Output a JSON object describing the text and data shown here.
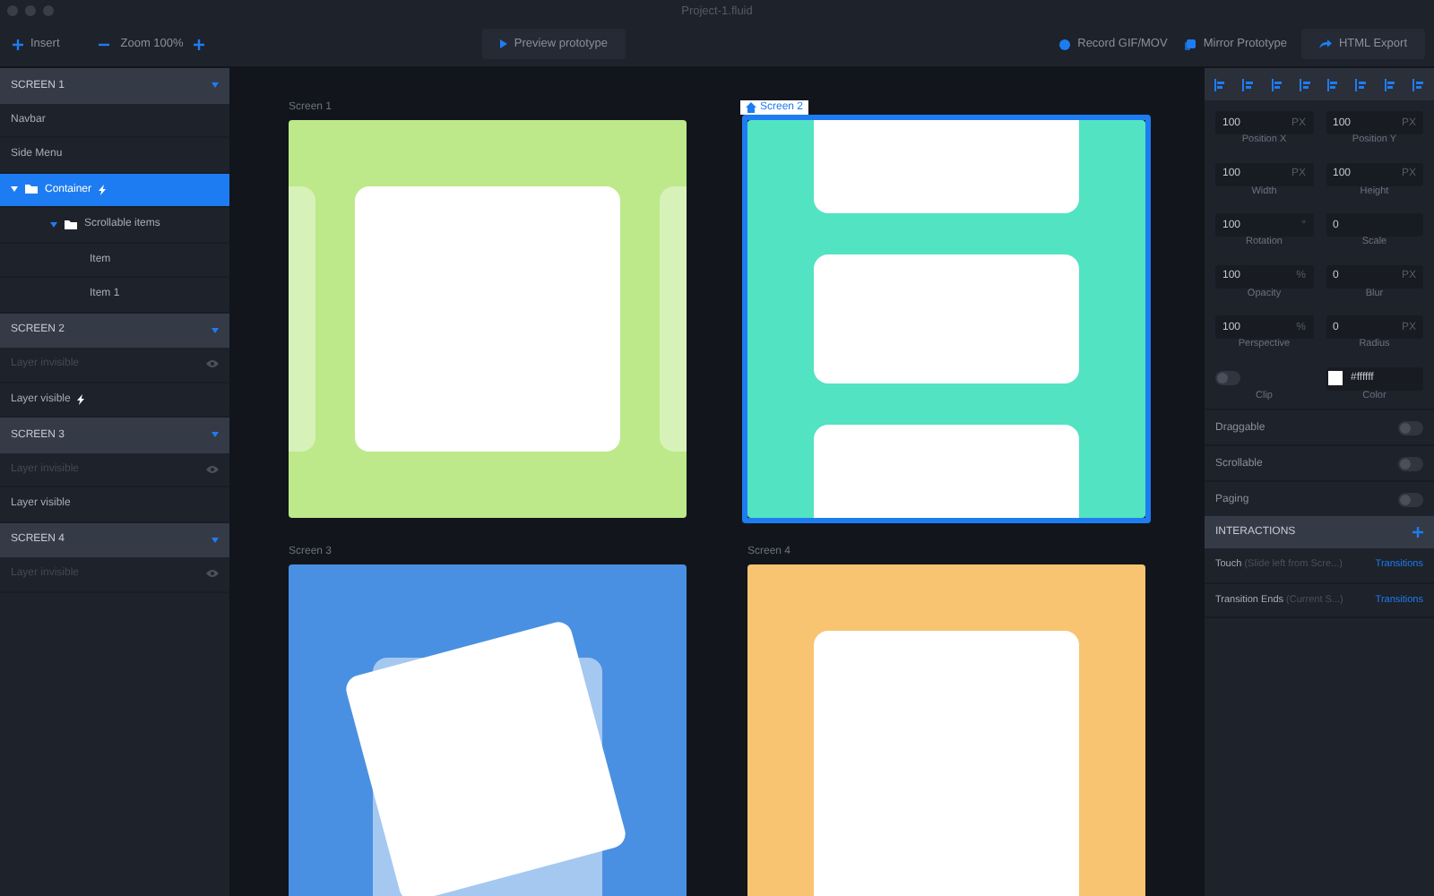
{
  "window": {
    "title": "Project-1.fluid"
  },
  "toolbar": {
    "insert": "Insert",
    "zoom": "Zoom 100%",
    "preview": "Preview prototype",
    "record": "Record GIF/MOV",
    "mirror": "Mirror Prototype",
    "export": "HTML Export"
  },
  "sidebar": {
    "groups": [
      {
        "title": "SCREEN 1",
        "expanded": true,
        "items": [
          {
            "label": "Navbar",
            "invisible": false,
            "interaction": false,
            "selected": false,
            "folder": false
          },
          {
            "label": "Side Menu",
            "invisible": false,
            "interaction": false,
            "selected": false,
            "folder": false
          },
          {
            "label": "Container",
            "invisible": false,
            "interaction": true,
            "selected": true,
            "folder": true,
            "expanded": true,
            "children": [
              {
                "label": "Scrollable items",
                "invisible": false,
                "interaction": false,
                "selected": false,
                "folder": true,
                "expanded": true,
                "children": [
                  {
                    "label": "Item",
                    "invisible": false,
                    "interaction": false,
                    "selected": false,
                    "folder": false
                  },
                  {
                    "label": "Item 1",
                    "invisible": false,
                    "interaction": false,
                    "selected": false,
                    "folder": false
                  }
                ]
              }
            ]
          }
        ]
      },
      {
        "title": "SCREEN 2",
        "expanded": true,
        "items": [
          {
            "label": "Layer invisible",
            "invisible": true,
            "interaction": false,
            "selected": false,
            "folder": false
          },
          {
            "label": "Layer visible",
            "invisible": false,
            "interaction": true,
            "selected": false,
            "folder": false
          }
        ]
      },
      {
        "title": "SCREEN 3",
        "expanded": true,
        "items": [
          {
            "label": "Layer invisible",
            "invisible": true,
            "interaction": false,
            "selected": false,
            "folder": false
          },
          {
            "label": "Layer visible",
            "invisible": false,
            "interaction": false,
            "selected": false,
            "folder": false
          }
        ]
      },
      {
        "title": "SCREEN 4",
        "expanded": true,
        "items": [
          {
            "label": "Layer invisible",
            "invisible": true,
            "interaction": false,
            "selected": false,
            "folder": false
          }
        ]
      }
    ]
  },
  "canvas": {
    "screens": [
      {
        "label": "Screen 1",
        "selected": false,
        "home": false,
        "kind": "carousel",
        "color": "#bde98a"
      },
      {
        "label": "Screen 2",
        "selected": true,
        "home": true,
        "kind": "list",
        "color": "#52e3c2"
      },
      {
        "label": "Screen 3",
        "selected": false,
        "home": false,
        "kind": "cards",
        "color": "#4a90e2"
      },
      {
        "label": "Screen 4",
        "selected": false,
        "home": false,
        "kind": "sheet",
        "color": "#f8c471"
      }
    ]
  },
  "inspector": {
    "fields": [
      {
        "value": "100",
        "unit": "PX",
        "caption": "Position X"
      },
      {
        "value": "100",
        "unit": "PX",
        "caption": "Position Y"
      },
      {
        "value": "100",
        "unit": "PX",
        "caption": "Width"
      },
      {
        "value": "100",
        "unit": "PX",
        "caption": "Height"
      },
      {
        "value": "100",
        "unit": "°",
        "caption": "Rotation"
      },
      {
        "value": "0",
        "caption": "Scale"
      },
      {
        "value": "100",
        "unit": "%",
        "caption": "Opacity"
      },
      {
        "value": "0",
        "unit": "PX",
        "caption": "Blur"
      },
      {
        "value": "100",
        "unit": "%",
        "caption": "Perspective"
      },
      {
        "value": "0",
        "unit": "PX",
        "caption": "Radius"
      }
    ],
    "clip": {
      "label": "Clip",
      "on": false
    },
    "color": {
      "label": "Color",
      "value": "#ffffff"
    },
    "toggles": [
      {
        "label": "Draggable",
        "on": false
      },
      {
        "label": "Scrollable",
        "on": false
      },
      {
        "label": "Paging",
        "on": false
      }
    ],
    "interactions": {
      "title": "INTERACTIONS",
      "rows": [
        {
          "trigger": "Touch",
          "detail": "(Slide left from Scre...)",
          "action": "Transitions"
        },
        {
          "trigger": "Transition Ends",
          "detail": "(Current S...)",
          "action": "Transitions"
        }
      ]
    }
  }
}
